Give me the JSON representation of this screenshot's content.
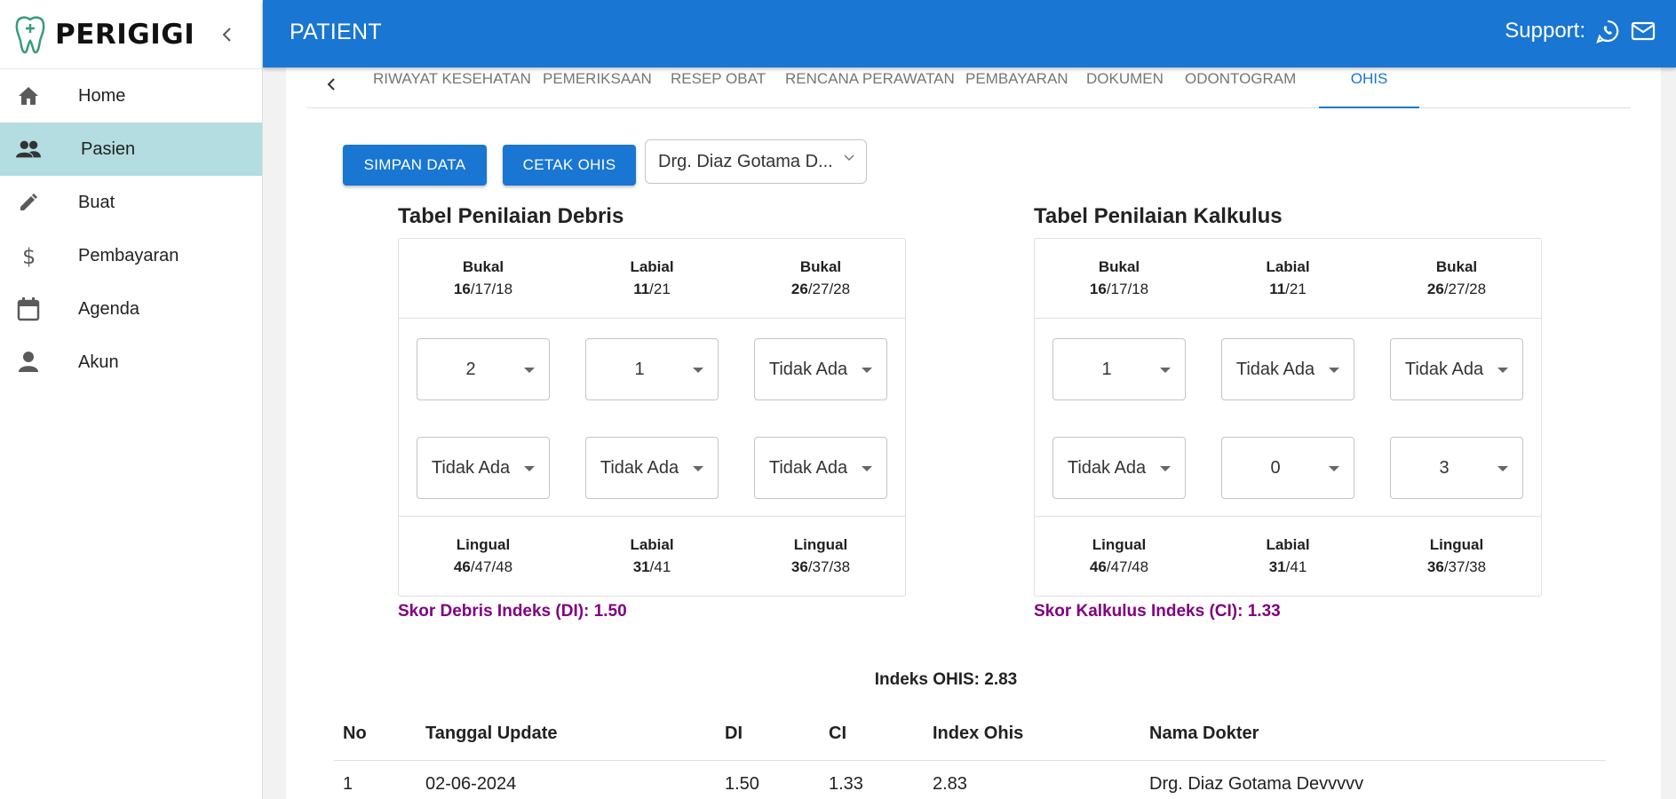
{
  "app": {
    "name": "PERIGIGI"
  },
  "sidebar": {
    "items": [
      {
        "label": "Home",
        "icon": "home-icon"
      },
      {
        "label": "Pasien",
        "icon": "people-icon"
      },
      {
        "label": "Buat",
        "icon": "pencil-icon"
      },
      {
        "label": "Pembayaran",
        "icon": "dollar-icon"
      },
      {
        "label": "Agenda",
        "icon": "calendar-icon"
      },
      {
        "label": "Akun",
        "icon": "person-icon"
      }
    ],
    "active": "Pasien"
  },
  "header": {
    "title": "PATIENT",
    "support_label": "Support:"
  },
  "tabs": {
    "items": [
      "RIWAYAT KESEHATAN",
      "PEMERIKSAAN",
      "RESEP OBAT",
      "RENCANA PERAWATAN",
      "PEMBAYARAN",
      "DOKUMEN",
      "ODONTOGRAM",
      "OHIS"
    ],
    "active": "OHIS"
  },
  "actions": {
    "save_label": "SIMPAN DATA",
    "print_label": "CETAK OHIS",
    "doctor_selected": "Drg. Diaz Gotama D..."
  },
  "debris": {
    "title": "Tabel Penilaian Debris",
    "top": [
      {
        "surface": "Bukal",
        "bold": "16",
        "rest": "/17/18"
      },
      {
        "surface": "Labial",
        "bold": "11",
        "rest": "/21"
      },
      {
        "surface": "Bukal",
        "bold": "26",
        "rest": "/27/28"
      }
    ],
    "row1": [
      "2",
      "1",
      "Tidak Ada"
    ],
    "row2": [
      "Tidak Ada",
      "Tidak Ada",
      "Tidak Ada"
    ],
    "bottom": [
      {
        "surface": "Lingual",
        "bold": "46",
        "rest": "/47/48"
      },
      {
        "surface": "Labial",
        "bold": "31",
        "rest": "/41"
      },
      {
        "surface": "Lingual",
        "bold": "36",
        "rest": "/37/38"
      }
    ],
    "score": "Skor Debris Indeks (DI): 1.50"
  },
  "calculus": {
    "title": "Tabel Penilaian Kalkulus",
    "top": [
      {
        "surface": "Bukal",
        "bold": "16",
        "rest": "/17/18"
      },
      {
        "surface": "Labial",
        "bold": "11",
        "rest": "/21"
      },
      {
        "surface": "Bukal",
        "bold": "26",
        "rest": "/27/28"
      }
    ],
    "row1": [
      "1",
      "Tidak Ada",
      "Tidak Ada"
    ],
    "row2": [
      "Tidak Ada",
      "0",
      "3"
    ],
    "bottom": [
      {
        "surface": "Lingual",
        "bold": "46",
        "rest": "/47/48"
      },
      {
        "surface": "Labial",
        "bold": "31",
        "rest": "/41"
      },
      {
        "surface": "Lingual",
        "bold": "36",
        "rest": "/37/38"
      }
    ],
    "score": "Skor Kalkulus Indeks (CI): 1.33"
  },
  "ohis_total": "Indeks OHIS: 2.83",
  "history": {
    "columns": [
      "No",
      "Tanggal Update",
      "DI",
      "CI",
      "Index Ohis",
      "Nama Dokter"
    ],
    "rows": [
      [
        "1",
        "02-06-2024",
        "1.50",
        "1.33",
        "2.83",
        "Drg. Diaz Gotama Devvvvv"
      ]
    ]
  },
  "colors": {
    "primary": "#1976d2",
    "active_nav": "#b3dde0",
    "score_text": "#800080"
  }
}
